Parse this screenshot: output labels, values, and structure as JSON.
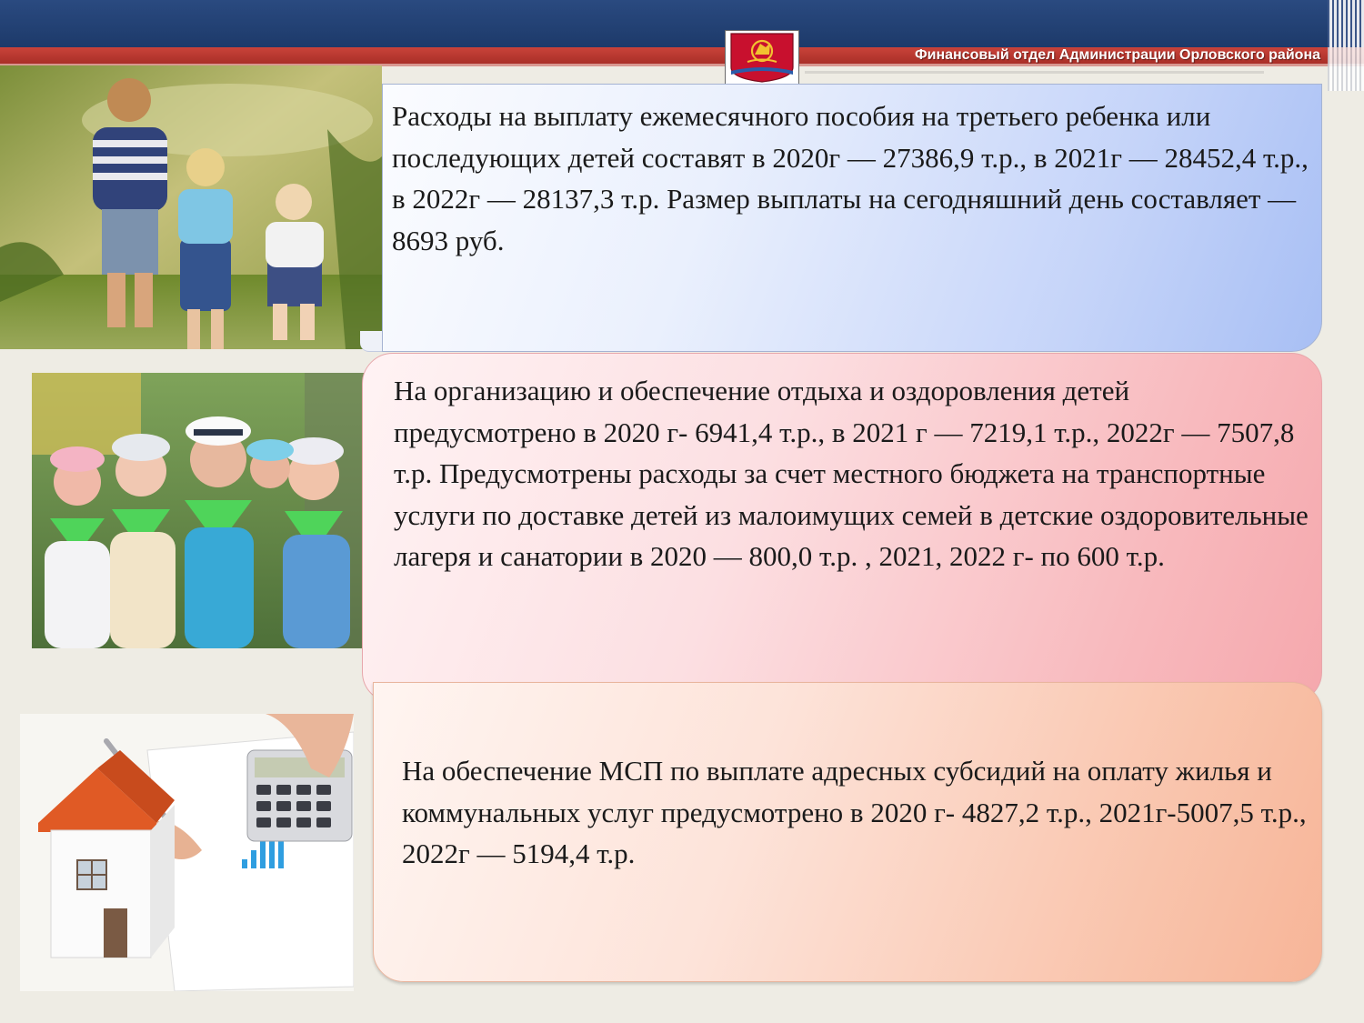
{
  "header": {
    "title": "Финансовый отдел Администрации Орловского района",
    "brand_blue": "#1d3a6a",
    "brand_red": "#b8372f"
  },
  "emblem": {
    "icon": "coat-of-arms-icon",
    "colors": [
      "#c8102e",
      "#f2c230",
      "#2a5caa"
    ]
  },
  "photos": [
    {
      "name": "children-by-lake-photo",
      "subject": "three children holding hands by a lake"
    },
    {
      "name": "children-camp-photo",
      "subject": "children in caps and green neckerchiefs"
    },
    {
      "name": "housing-finance-photo",
      "subject": "house model, calculator and documents"
    }
  ],
  "boxes": [
    {
      "color": "#c5d4f9",
      "text": "Расходы на выплату ежемесячного пособия на третьего ребенка или последующих детей составят в 2020г — 27386,9 т.р., в 2021г — 28452,4 т.р., в 2022г — 28137,3 т.р. Размер выплаты на сегодняшний день составляет — 8693 руб."
    },
    {
      "color": "#f8b9bd",
      "text": "На организацию и обеспечение отдыха и оздоровления детей предусмотрено в 2020 г- 6941,4 т.р., в 2021 г — 7219,1 т.р., 2022г — 7507,8 т.р.  Предусмотрены расходы за счет местного бюджета на транспортные услуги по доставке детей из малоимущих семей в детские оздоровительные лагеря и санатории в  2020 — 800,0 т.р. , 2021, 2022 г- по 600 т.р."
    },
    {
      "color": "#f9c4ac",
      "text": "На обеспечение МСП по выплате адресных субсидий на оплату жилья и коммунальных услуг предусмотрено в 2020 г- 4827,2 т.р., 2021г-5007,5 т.р., 2022г — 5194,4 т.р."
    }
  ]
}
